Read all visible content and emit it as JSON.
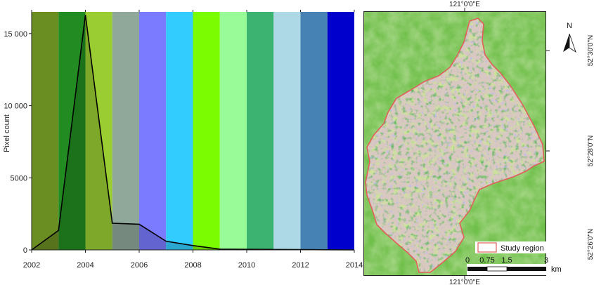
{
  "chart_data": {
    "type": "area",
    "title": "",
    "xlabel": "",
    "ylabel": "Pixel count",
    "xlim": [
      2002,
      2014
    ],
    "ylim": [
      0,
      16500
    ],
    "grid": false,
    "x_ticks": [
      "2002",
      "2004",
      "2006",
      "2008",
      "2010",
      "2012",
      "2014"
    ],
    "y_ticks": [
      "0",
      "5000",
      "10 000",
      "15 000"
    ],
    "bands": [
      {
        "from": 2002,
        "to": 2003,
        "color": "#6b8e23"
      },
      {
        "from": 2003,
        "to": 2004,
        "color": "#228b22"
      },
      {
        "from": 2004,
        "to": 2005,
        "color": "#9acd32"
      },
      {
        "from": 2005,
        "to": 2006,
        "color": "#8fa89a"
      },
      {
        "from": 2006,
        "to": 2007,
        "color": "#7b7bff"
      },
      {
        "from": 2007,
        "to": 2008,
        "color": "#33ccff"
      },
      {
        "from": 2008,
        "to": 2009,
        "color": "#7cfc00"
      },
      {
        "from": 2009,
        "to": 2010,
        "color": "#98fb98"
      },
      {
        "from": 2010,
        "to": 2011,
        "color": "#3cb371"
      },
      {
        "from": 2011,
        "to": 2012,
        "color": "#add8e6"
      },
      {
        "from": 2012,
        "to": 2013,
        "color": "#4682b4"
      },
      {
        "from": 2013,
        "to": 2014,
        "color": "#0000cd"
      }
    ],
    "series": [
      {
        "x": [
          2002,
          2003,
          2004,
          2005,
          2006,
          2007,
          2008,
          2009,
          2010,
          2011,
          2012,
          2013,
          2014
        ],
        "values": [
          0,
          1350,
          16300,
          1850,
          1780,
          600,
          300,
          50,
          40,
          30,
          20,
          10,
          0
        ]
      }
    ]
  },
  "map": {
    "top_coord": "121°0'0\"E",
    "bottom_coord": "121°0'0\"E",
    "right_coords": [
      "52°30'0\"N",
      "52°28'0\"N",
      "52°26'0\"N"
    ],
    "north_label": "N",
    "legend_label": "Study region",
    "scale_labels": [
      "0",
      "0.75",
      "1.5",
      "3"
    ],
    "scale_unit": "km",
    "colors": {
      "background_green": "#6fbf4a",
      "boundary": "#e0605a",
      "bare": "#d9c7c2",
      "forest_dark": "#1f7a1f",
      "water": "#7b7bff"
    }
  }
}
